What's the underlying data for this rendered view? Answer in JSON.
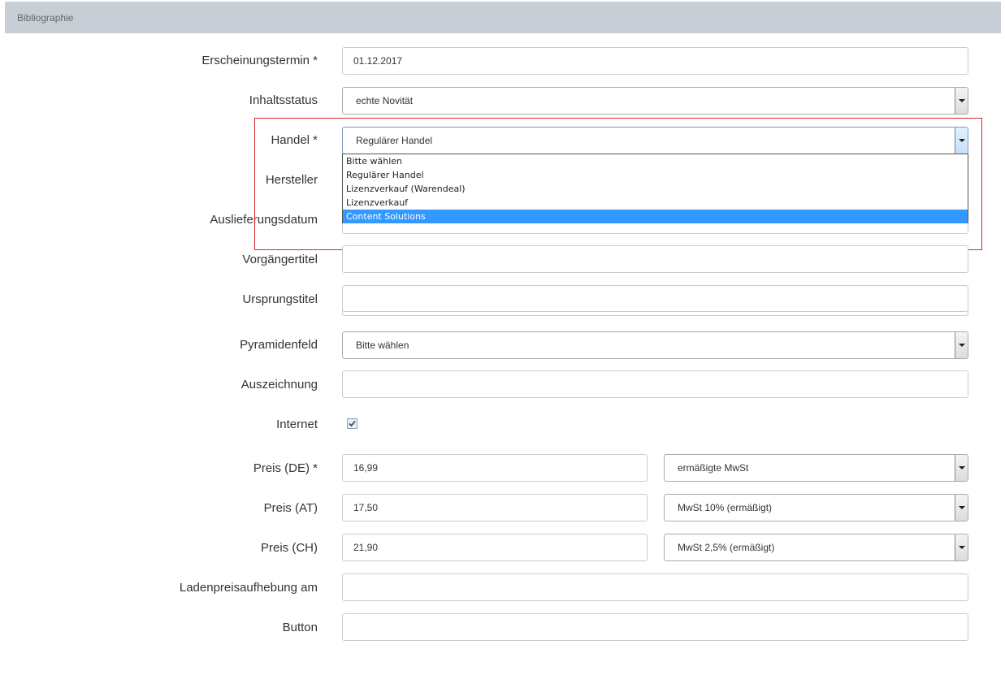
{
  "panel": {
    "title": "Bibliographie"
  },
  "fields": {
    "erscheinungstermin": {
      "label": "Erscheinungstermin *",
      "value": "01.12.2017"
    },
    "inhaltsstatus": {
      "label": "Inhaltsstatus",
      "value": "echte Novität"
    },
    "handel": {
      "label": "Handel *",
      "value": "Regulärer Handel",
      "options": [
        "Bitte wählen",
        "Regulärer Handel",
        "Lizenzverkauf (Warendeal)",
        "Lizenzverkauf",
        "Content Solutions"
      ],
      "highlighted_option": "Content Solutions"
    },
    "hersteller": {
      "label": "Hersteller"
    },
    "auslieferungsdatum": {
      "label": "Auslieferungsdatum"
    },
    "vorgaengertitel": {
      "label": "Vorgängertitel",
      "value": ""
    },
    "ursprungstitel": {
      "label": "Ursprungstitel",
      "value": ""
    },
    "pyramidenfeld": {
      "label": "Pyramidenfeld",
      "value": "Bitte wählen"
    },
    "auszeichnung": {
      "label": "Auszeichnung",
      "value": ""
    },
    "internet": {
      "label": "Internet",
      "checked": true
    },
    "preis_de": {
      "label": "Preis (DE) *",
      "value": "16,99",
      "tax": "ermäßigte MwSt"
    },
    "preis_at": {
      "label": "Preis (AT)",
      "value": "17,50",
      "tax": "MwSt 10% (ermäßigt)"
    },
    "preis_ch": {
      "label": "Preis (CH)",
      "value": "21,90",
      "tax": "MwSt 2,5% (ermäßigt)"
    },
    "ladenpreisaufhebung": {
      "label": "Ladenpreisaufhebung am",
      "value": ""
    },
    "button": {
      "label": "Button",
      "value": ""
    }
  },
  "colors": {
    "highlight": "#d9232d",
    "selected_option": "#3399ff",
    "header_bg": "#c8ced6"
  }
}
